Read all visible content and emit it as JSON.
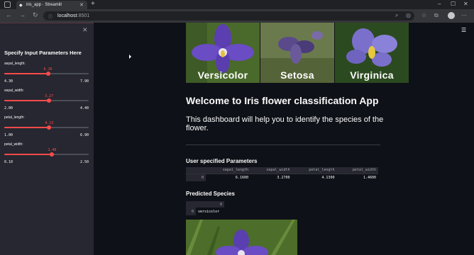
{
  "browser": {
    "tab_title": "iris_app · Streamlit",
    "url_host": "localhost",
    "url_port": ":8501"
  },
  "sidebar": {
    "title": "Specify Input Parameters Here",
    "sliders": [
      {
        "label": "sepal_length:",
        "value": "6.16",
        "min": "4.30",
        "max": "7.90",
        "fraction": 0.517
      },
      {
        "label": "sepal_width:",
        "value": "3.27",
        "min": "2.00",
        "max": "4.40",
        "fraction": 0.529
      },
      {
        "label": "petal_length:",
        "value": "4.13",
        "min": "1.00",
        "max": "6.90",
        "fraction": 0.531
      },
      {
        "label": "petal_width:",
        "value": "1.46",
        "min": "0.10",
        "max": "2.50",
        "fraction": 0.567
      }
    ]
  },
  "hero": {
    "captions": [
      "Versicolor",
      "Setosa",
      "Virginica"
    ]
  },
  "main": {
    "heading": "Welcome to Iris flower classification App",
    "intro": "This dashboard will help you to identify the species of the flower.",
    "params_heading": "User specified Parameters",
    "params_table": {
      "columns": [
        "sepal_length",
        "sepal_width",
        "petal_length",
        "petal_width"
      ],
      "row_index": "0",
      "row": [
        "6.1600",
        "3.2700",
        "4.1300",
        "1.4600"
      ]
    },
    "species_heading": "Predicted Species",
    "species_table": {
      "column": "0",
      "row_index": "0",
      "value": "versicolor"
    }
  },
  "colors": {
    "accent": "#ff4b4b",
    "background": "#0e1117",
    "sidebar": "#262730"
  },
  "icons": [
    "close-icon",
    "hamburger-menu-icon",
    "back-icon",
    "forward-icon",
    "reload-icon",
    "info-icon"
  ]
}
